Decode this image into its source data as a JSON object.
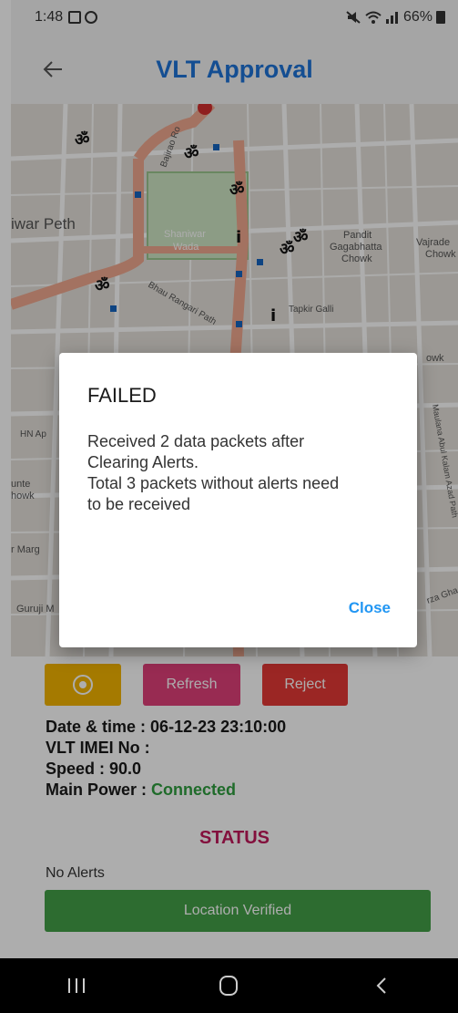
{
  "status_bar": {
    "time": "1:48",
    "battery": "66%"
  },
  "app_bar": {
    "title": "VLT Approval"
  },
  "map": {
    "labels": [
      "iwar Peth",
      "Shaniwar",
      "Wada",
      "Pandit",
      "Gagabhatta",
      "Chowk",
      "Vajrade",
      "Chowk",
      "Bajirao Ro",
      "Bhau Rangari Path",
      "Tapkir Galli",
      "HN Ap",
      "unte",
      "howk",
      "r Marg",
      "Guruji M",
      "Maulana Abul Kalam Azad Path",
      "rza Gha",
      "owk"
    ]
  },
  "buttons": {
    "refresh": "Refresh",
    "reject": "Reject"
  },
  "info": {
    "datetime_label": "Date & time :",
    "datetime_value": "06-12-23 23:10:00",
    "imei_label": "VLT IMEI No :",
    "speed_label": "Speed :",
    "speed_value": "90.0",
    "power_label": "Main Power :",
    "power_value": "Connected"
  },
  "status_heading": "STATUS",
  "alerts": "No Alerts",
  "verified": "Location Verified",
  "dialog": {
    "title": "FAILED",
    "line1": "Received 2 data packets after",
    "line2": "Clearing Alerts.",
    "line3": "Total 3 packets without alerts need",
    "line4": "to be received",
    "close": "Close"
  },
  "colors": {
    "title_blue": "#1e73d8",
    "locate_yellow": "#f4b400",
    "refresh_pink": "#e0407a",
    "reject_red": "#e53935",
    "connected_green": "#2e9e3e",
    "status_magenta": "#c2185b",
    "verified_green": "#43a047",
    "close_blue": "#2196f3"
  }
}
